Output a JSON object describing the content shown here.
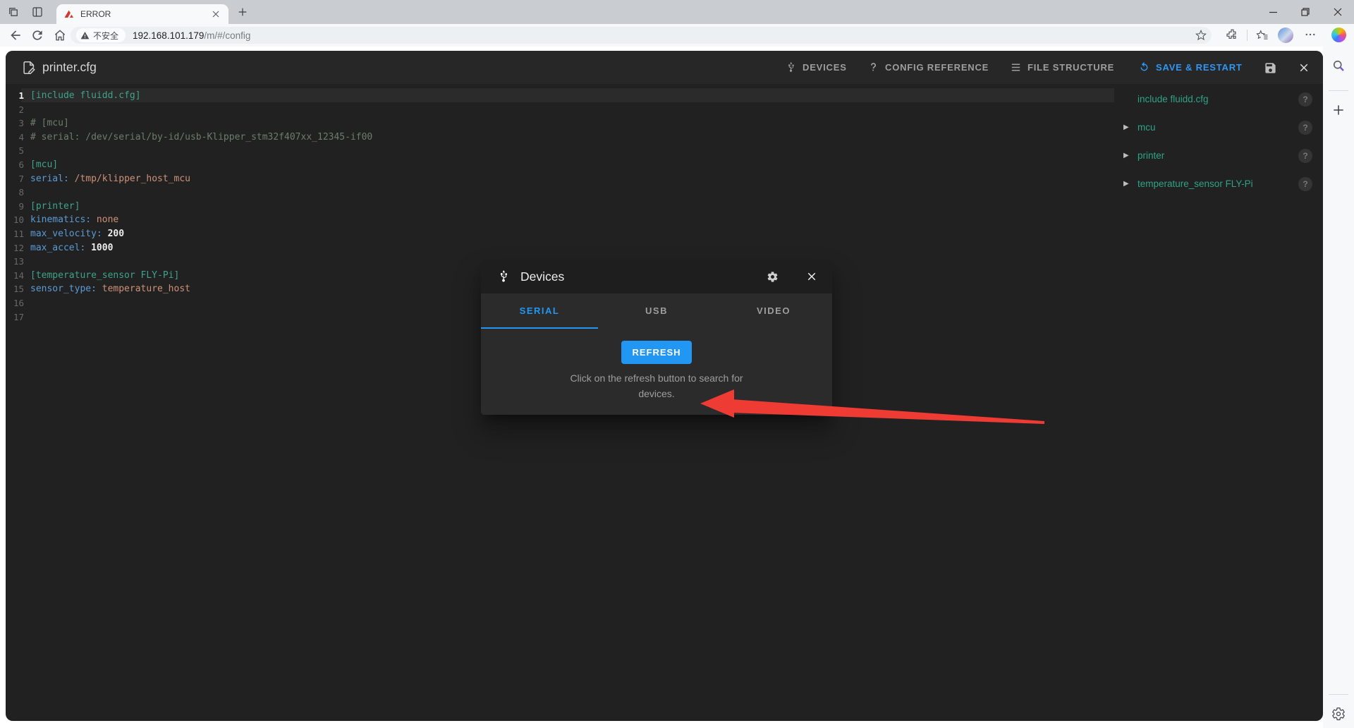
{
  "browser": {
    "tab": {
      "title": "ERROR"
    },
    "address": {
      "security_label": "不安全",
      "url_host": "192.168.101.179",
      "url_path": "/m/#/config"
    }
  },
  "app": {
    "toolbar": {
      "title": "printer.cfg",
      "devices_label": "DEVICES",
      "config_reference_label": "CONFIG REFERENCE",
      "file_structure_label": "FILE STRUCTURE",
      "save_restart_label": "SAVE & RESTART"
    },
    "editor": {
      "lines": [
        {
          "n": "1",
          "active": true,
          "tokens": [
            {
              "t": "[include fluidd.cfg]",
              "c": "section"
            }
          ]
        },
        {
          "n": "2",
          "tokens": []
        },
        {
          "n": "3",
          "tokens": [
            {
              "t": "# [mcu]",
              "c": "comment"
            }
          ]
        },
        {
          "n": "4",
          "tokens": [
            {
              "t": "# serial: /dev/serial/by-id/usb-Klipper_stm32f407xx_12345-if00",
              "c": "comment"
            }
          ]
        },
        {
          "n": "5",
          "tokens": []
        },
        {
          "n": "6",
          "tokens": [
            {
              "t": "[mcu]",
              "c": "section"
            }
          ]
        },
        {
          "n": "7",
          "tokens": [
            {
              "t": "serial:",
              "c": "key"
            },
            {
              "t": " /tmp/klipper_host_mcu",
              "c": "value"
            }
          ]
        },
        {
          "n": "8",
          "tokens": []
        },
        {
          "n": "9",
          "tokens": [
            {
              "t": "[printer]",
              "c": "section"
            }
          ]
        },
        {
          "n": "10",
          "tokens": [
            {
              "t": "kinematics:",
              "c": "key"
            },
            {
              "t": " none",
              "c": "value"
            }
          ]
        },
        {
          "n": "11",
          "tokens": [
            {
              "t": "max_velocity:",
              "c": "key"
            },
            {
              "t": " ",
              "c": "value"
            },
            {
              "t": "200",
              "c": "number"
            }
          ]
        },
        {
          "n": "12",
          "tokens": [
            {
              "t": "max_accel:",
              "c": "key"
            },
            {
              "t": " ",
              "c": "value"
            },
            {
              "t": "1000",
              "c": "number"
            }
          ]
        },
        {
          "n": "13",
          "tokens": []
        },
        {
          "n": "14",
          "tokens": [
            {
              "t": "[temperature_sensor FLY-Pi]",
              "c": "section"
            }
          ]
        },
        {
          "n": "15",
          "tokens": [
            {
              "t": "sensor_type:",
              "c": "key"
            },
            {
              "t": " temperature_host",
              "c": "value"
            }
          ]
        },
        {
          "n": "16",
          "tokens": []
        },
        {
          "n": "17",
          "tokens": []
        }
      ]
    },
    "structure_panel": {
      "items": [
        {
          "label": "include fluidd.cfg",
          "expandable": false
        },
        {
          "label": "mcu",
          "expandable": true
        },
        {
          "label": "printer",
          "expandable": true
        },
        {
          "label": "temperature_sensor FLY-Pi",
          "expandable": true
        }
      ]
    }
  },
  "modal": {
    "title": "Devices",
    "tabs": [
      {
        "label": "SERIAL",
        "active": true
      },
      {
        "label": "USB",
        "active": false
      },
      {
        "label": "VIDEO",
        "active": false
      }
    ],
    "refresh_label": "REFRESH",
    "hint_line1": "Click on the refresh button to search for",
    "hint_line2": "devices."
  },
  "icons": {
    "help_glyph": "?",
    "expand_glyph": "▶"
  },
  "colors": {
    "accent_blue": "#2196f3",
    "section_green": "#3fa389",
    "key_blue": "#5b9bd3",
    "value_salmon": "#ce9178",
    "annotation_red": "#ee3b33"
  }
}
